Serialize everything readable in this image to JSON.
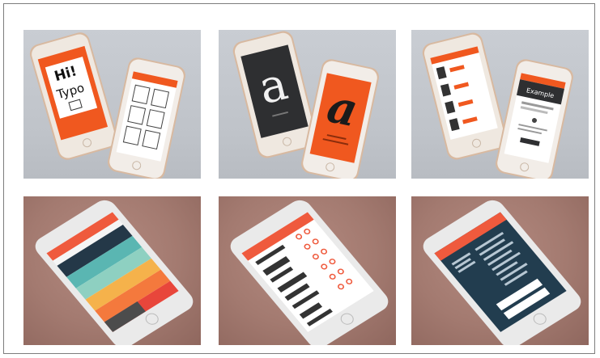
{
  "tiles": [
    {
      "id": "tile-typo-intro",
      "screen_text": [
        "Hi!",
        "Typo"
      ]
    },
    {
      "id": "tile-letter-a",
      "screen_text": [
        "a",
        "a"
      ]
    },
    {
      "id": "tile-list-detail",
      "screen_text": [
        "Example"
      ]
    },
    {
      "id": "tile-colored-menu",
      "screen_text": []
    },
    {
      "id": "tile-font-list",
      "screen_text": []
    },
    {
      "id": "tile-dark-quiz",
      "screen_text": []
    }
  ],
  "colors": {
    "accent_orange": "#f0581f",
    "dark_screen": "#2e2f31",
    "phone_body": "#ece4dc",
    "gold_edge": "#d8b9a0",
    "gray_bg": "#c3c7cd",
    "rose_bg": "#a47b71"
  }
}
